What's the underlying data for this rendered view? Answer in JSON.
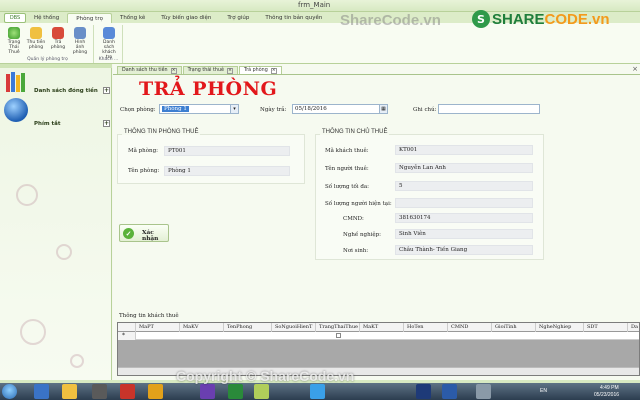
{
  "window": {
    "title": "frm_Main"
  },
  "watermark": {
    "brand_prefix": "SHARE",
    "brand_suffix": "CODE.vn",
    "logo_letter": "S",
    "site_text": "ShareCode.vn",
    "copyright": "Copyright © ShareCode.vn"
  },
  "ribbon": {
    "app_button": "DBS",
    "tabs": [
      "Hệ thống",
      "Phòng trọ",
      "Thống kê",
      "Tùy biến giao diện",
      "Trợ giúp",
      "Thông tin bản quyền"
    ],
    "active_tab": "Phòng trọ",
    "groups": [
      {
        "label": "Quản lý phòng trọ",
        "buttons": [
          "Trạng Thái Thuê",
          "Thu tiền phòng",
          "Trả phòng",
          "Hình ảnh phòng"
        ]
      },
      {
        "label": "Khách ...",
        "buttons": [
          "Danh sách khách trọ"
        ]
      }
    ]
  },
  "left_panel": {
    "items": [
      {
        "label": "Danh sách đóng tiền"
      },
      {
        "label": "Phím tắt"
      }
    ]
  },
  "doc_tabs": [
    "Danh sách thu tiền",
    "Trạng thái thuê",
    "Trả phòng"
  ],
  "form": {
    "title": "TRẢ PHÒNG",
    "chon_phong_label": "Chọn phòng:",
    "chon_phong_value": "Phòng 1",
    "ngay_tra_label": "Ngày trả:",
    "ngay_tra_value": "05/18/2016",
    "ghi_chu_label": "Ghi chú:",
    "ghi_chu_value": "",
    "room_info": {
      "title": "THÔNG TIN PHÒNG THUÊ",
      "ma_phong_label": "Mã phòng:",
      "ma_phong_value": "PT001",
      "ten_phong_label": "Tên phòng:",
      "ten_phong_value": "Phòng 1"
    },
    "owner_info": {
      "title": "THÔNG TIN CHỦ THUÊ",
      "fields": [
        {
          "label": "Mã khách thuê:",
          "value": "KT001"
        },
        {
          "label": "Tên người thuê:",
          "value": "Nguyễn Lan Anh"
        },
        {
          "label": "Số lượng tối đa:",
          "value": "5"
        },
        {
          "label": "Số lượng người hiện tại:",
          "value": ""
        },
        {
          "label": "CMND:",
          "value": "381630174"
        },
        {
          "label": "Nghề nghiệp:",
          "value": "Sinh Viên"
        },
        {
          "label": "Nơi sinh:",
          "value": "Châu Thành- Tiền Giang"
        }
      ]
    },
    "confirm_button": "Xác nhận",
    "tenant_grid_label": "Thông tin khách thuê",
    "grid_columns": [
      "MaPT",
      "MaKV",
      "TenPhong",
      "SoNguoiHienT",
      "TrangThaiThue",
      "MaKT",
      "HoTen",
      "CMND",
      "GioiTinh",
      "NgheNghiep",
      "SDT",
      "Da"
    ],
    "new_row_marker": "*"
  },
  "taskbar": {
    "lang": "EN",
    "time": "4:49 PM",
    "date": "05/23/2016"
  }
}
